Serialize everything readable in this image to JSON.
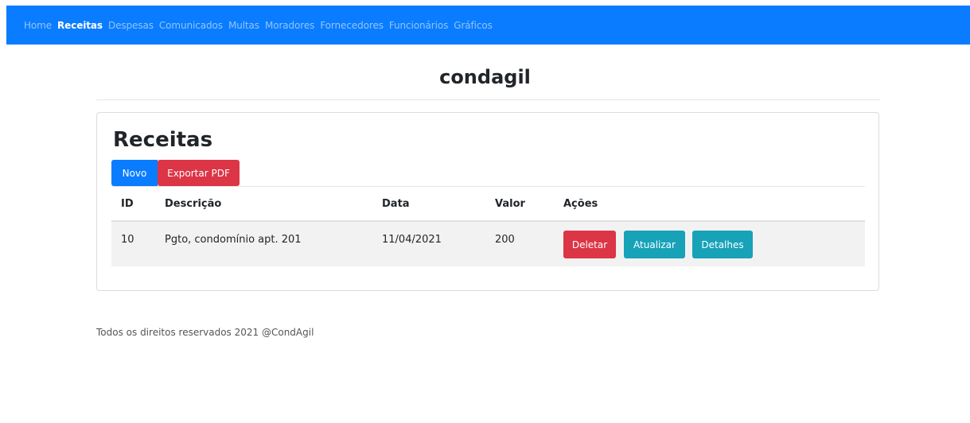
{
  "nav": {
    "items": [
      {
        "label": "Home",
        "active": false
      },
      {
        "label": "Receitas",
        "active": true
      },
      {
        "label": "Despesas",
        "active": false
      },
      {
        "label": "Comunicados",
        "active": false
      },
      {
        "label": "Multas",
        "active": false
      },
      {
        "label": "Moradores",
        "active": false
      },
      {
        "label": "Fornecedores",
        "active": false
      },
      {
        "label": "Funcionários",
        "active": false
      },
      {
        "label": "Gráficos",
        "active": false
      }
    ],
    "color": "#0a7cff"
  },
  "brand": "condagil",
  "card": {
    "title": "Receitas",
    "new_button": "Novo",
    "export_button": "Exportar PDF"
  },
  "table": {
    "headers": {
      "id": "ID",
      "descricao": "Descrição",
      "data": "Data",
      "valor": "Valor",
      "acoes": "Ações"
    },
    "rows": [
      {
        "id": "10",
        "descricao": "Pgto, condomínio apt. 201",
        "data": "11/04/2021",
        "valor": "200",
        "delete_label": "Deletar",
        "update_label": "Atualizar",
        "details_label": "Detalhes"
      }
    ]
  },
  "footer": "Todos os direitos reservados 2021 @CondAgil"
}
